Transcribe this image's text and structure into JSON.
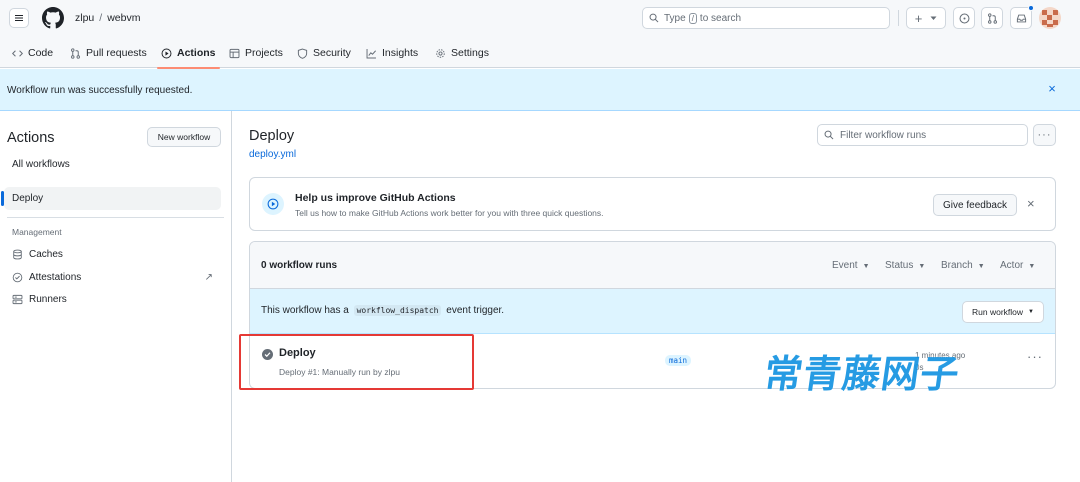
{
  "header": {
    "owner": "zlpu",
    "separator": "/",
    "repo": "webvm",
    "search": {
      "prefix": "Type",
      "key": "/",
      "suffix": "to search"
    },
    "plus_label": "+"
  },
  "nav": {
    "tabs": [
      {
        "label": "Code",
        "icon": "code-icon"
      },
      {
        "label": "Pull requests",
        "icon": "git-pull-request-icon"
      },
      {
        "label": "Actions",
        "icon": "play-icon",
        "active": true
      },
      {
        "label": "Projects",
        "icon": "table-icon"
      },
      {
        "label": "Security",
        "icon": "shield-icon"
      },
      {
        "label": "Insights",
        "icon": "graph-icon"
      },
      {
        "label": "Settings",
        "icon": "gear-icon"
      }
    ]
  },
  "flash": {
    "message": "Workflow run was successfully requested.",
    "close": "×"
  },
  "sidebar": {
    "title": "Actions",
    "new_workflow": "New workflow",
    "all_workflows": "All workflows",
    "active_workflow": "Deploy",
    "management_label": "Management",
    "management": [
      {
        "label": "Caches",
        "icon": "database-icon"
      },
      {
        "label": "Attestations",
        "icon": "verified-icon"
      },
      {
        "label": "Runners",
        "icon": "server-icon"
      }
    ],
    "external_arrow": "↗"
  },
  "main": {
    "title": "Deploy",
    "file": "deploy.yml",
    "filter_placeholder": "Filter workflow runs",
    "kebab": "···",
    "feedback": {
      "title": "Help us improve GitHub Actions",
      "subtitle": "Tell us how to make GitHub Actions work better for you with three quick questions.",
      "button": "Give feedback",
      "close": "×"
    },
    "runs": {
      "count_label": "0 workflow runs",
      "filters": [
        "Event",
        "Status",
        "Branch",
        "Actor"
      ],
      "dispatch_before": "This workflow has a",
      "dispatch_code": "workflow_dispatch",
      "dispatch_after": "event trigger.",
      "run_workflow_button": "Run workflow",
      "row": {
        "title": "Deploy",
        "subtitle": "Deploy #1: Manually run by zlpu",
        "branch": "main",
        "meta_line1": "1 minutes ago",
        "meta_line2": "0s"
      }
    }
  },
  "watermark": "常青藤网子",
  "colors": {
    "accent": "#0969da",
    "flash_bg": "#ddf4ff",
    "highlight": "#e53935",
    "tab_underline": "#fd8c73"
  }
}
